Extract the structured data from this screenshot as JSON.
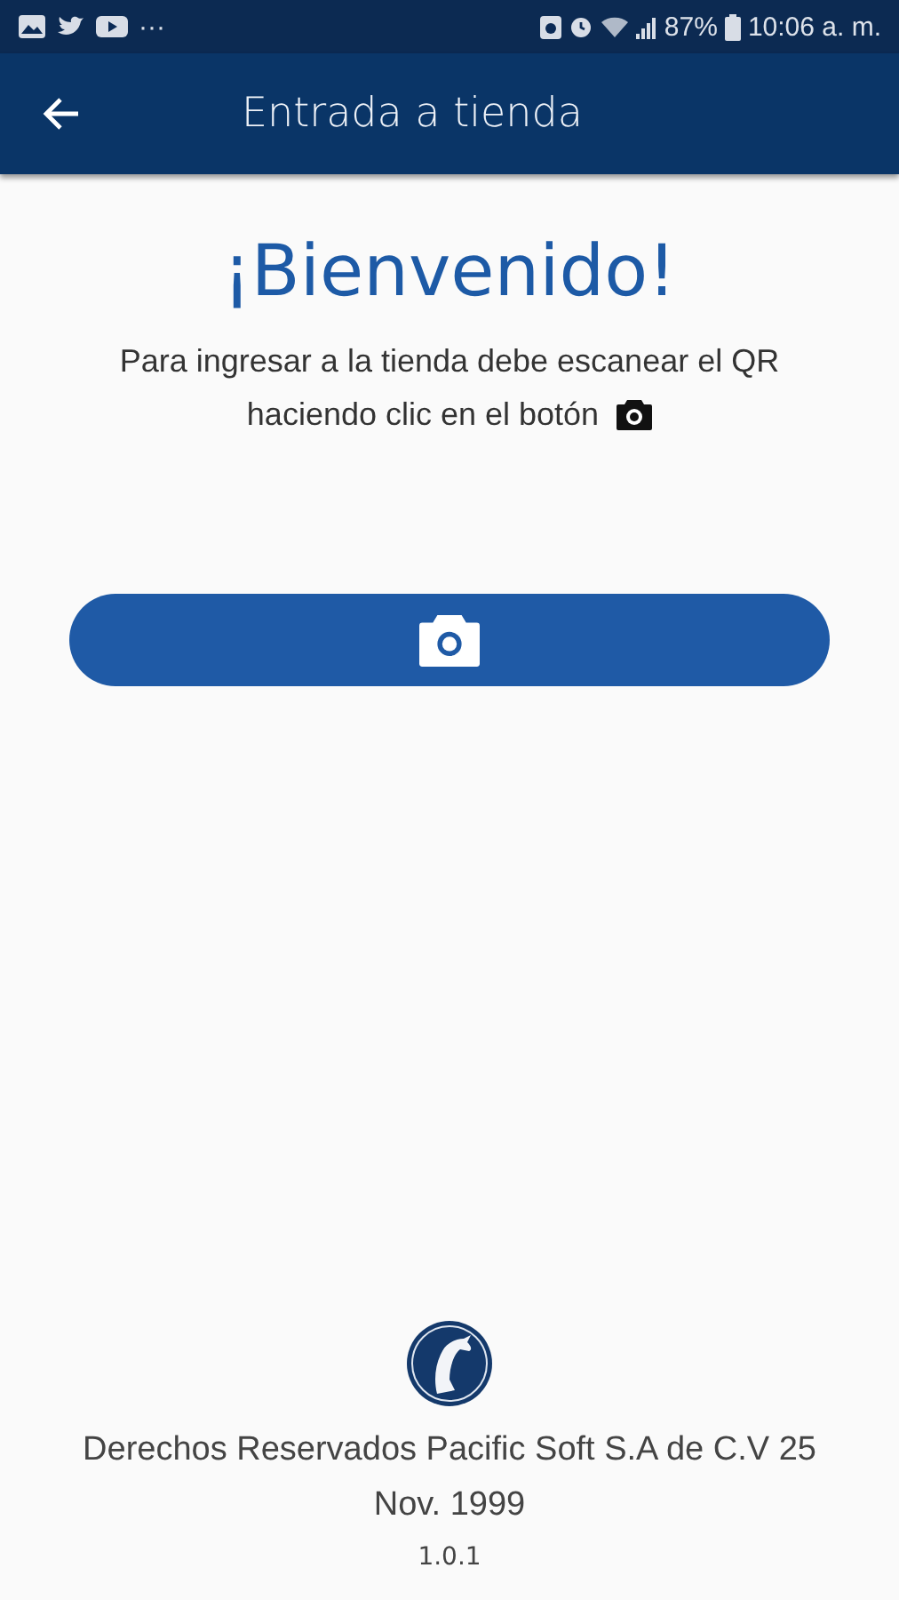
{
  "status_bar": {
    "more": "···",
    "battery": "87%",
    "time": "10:06 a. m."
  },
  "app_bar": {
    "title": "Entrada a tienda"
  },
  "welcome": {
    "heading": "¡Bienvenido!",
    "instructions": [
      "Para ingresar a la tienda debe escanear el QR",
      "haciendo clic en el botón"
    ]
  },
  "footer": {
    "copyright": "Derechos Reservados Pacific Soft S.A de C.V 25 Nov. 1999",
    "version": "1.0.1"
  }
}
